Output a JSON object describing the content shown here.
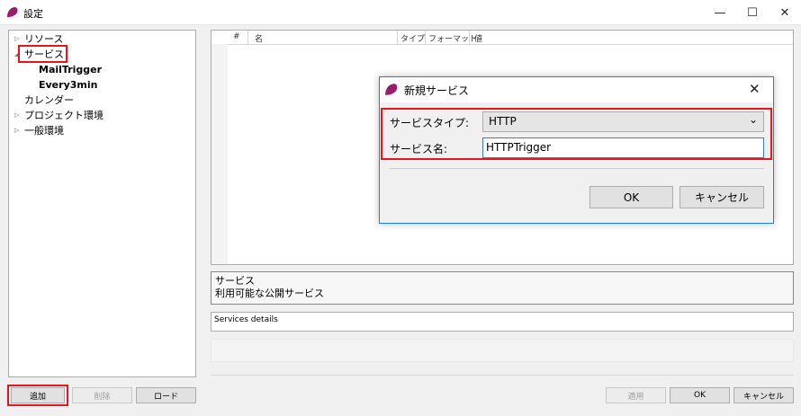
{
  "window": {
    "title": "設定",
    "minimize": "—",
    "maximize": "☐",
    "close": "✕"
  },
  "tree": {
    "items": [
      {
        "label": "リソース",
        "expander": "▷"
      },
      {
        "label": "サービス",
        "expander": "◢"
      },
      {
        "label": "MailTrigger"
      },
      {
        "label": "Every3min"
      },
      {
        "label": "カレンダー"
      },
      {
        "label": "プロジェクト環境",
        "expander": "▷"
      },
      {
        "label": "一般環境",
        "expander": "▷"
      }
    ]
  },
  "grid": {
    "columns": [
      "#",
      "名",
      "タイプ",
      "フォーマット",
      "値"
    ]
  },
  "description": {
    "title": "サービス",
    "text": "利用可能な公開サービス"
  },
  "details": {
    "text": "Services details"
  },
  "left_buttons": {
    "add": "追加",
    "delete": "削除",
    "load": "ロード"
  },
  "bottom_buttons": {
    "apply": "適用",
    "ok": "OK",
    "cancel": "キャンセル"
  },
  "dialog": {
    "title": "新規サービス",
    "close": "✕",
    "service_type_label": "サービスタイプ:",
    "service_type_value": "HTTP",
    "service_type_arrow": "⌄",
    "service_name_label": "サービス名:",
    "service_name_value": "HTTPTrigger",
    "ok": "OK",
    "cancel": "キャンセル"
  },
  "colors": {
    "highlight": "#e8141e",
    "accent": "#1883d7",
    "app_icon": "#9b1b6e"
  }
}
